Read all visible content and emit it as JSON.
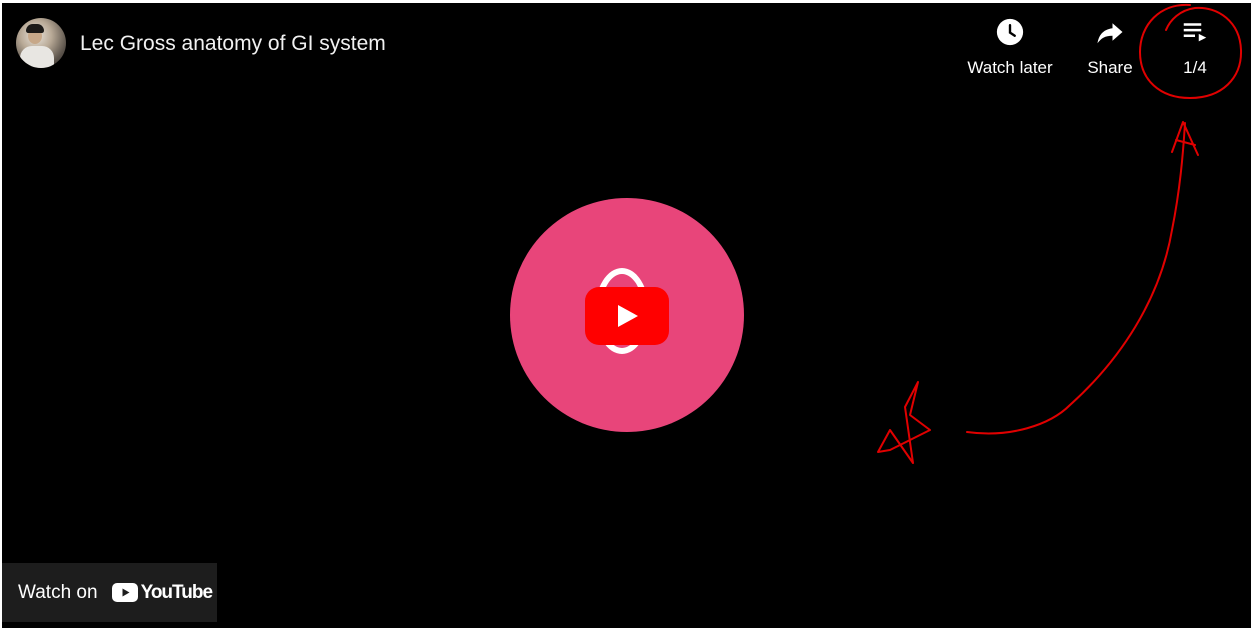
{
  "video": {
    "title": "Lec Gross anatomy of GI system",
    "channel_avatar_icon": "channel-avatar"
  },
  "controls": {
    "watch_later": {
      "label": "Watch later",
      "icon": "clock-icon"
    },
    "share": {
      "label": "Share",
      "icon": "share-arrow-icon"
    },
    "playlist": {
      "label": "1/4",
      "icon": "playlist-icon"
    }
  },
  "player": {
    "play_icon": "play-icon",
    "thumbnail_color": "#e8457a",
    "play_button_color": "#ff0000"
  },
  "footer": {
    "watch_on_label": "Watch on",
    "brand_wordmark": "YouTube"
  },
  "annotations": {
    "color": "#e00000",
    "marks": [
      "circle around playlist counter",
      "curved arrow pointing up to playlist",
      "hand-drawn star"
    ]
  }
}
